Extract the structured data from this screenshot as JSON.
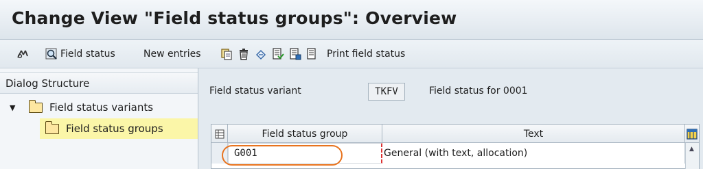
{
  "window": {
    "title": "Change View \"Field status groups\": Overview"
  },
  "toolbar": {
    "field_status_label": "Field status",
    "new_entries_label": "New entries",
    "print_field_status_label": "Print field status"
  },
  "dialog_structure": {
    "header": "Dialog Structure",
    "items": [
      {
        "label": "Field status variants",
        "expanded": true,
        "selected": false
      },
      {
        "label": "Field status groups",
        "selected": true
      }
    ]
  },
  "detail": {
    "variant_label": "Field status variant",
    "variant_value": "TKFV",
    "variant_desc": "Field status for 0001"
  },
  "table": {
    "columns": [
      "Field status group",
      "Text"
    ],
    "rows": [
      {
        "group": "G001",
        "text": "General (with text, allocation)"
      }
    ]
  },
  "colors": {
    "selected_row": "#fbf6a8",
    "highlight_oval": "#e8731e",
    "required_marker": "#dd3333"
  }
}
